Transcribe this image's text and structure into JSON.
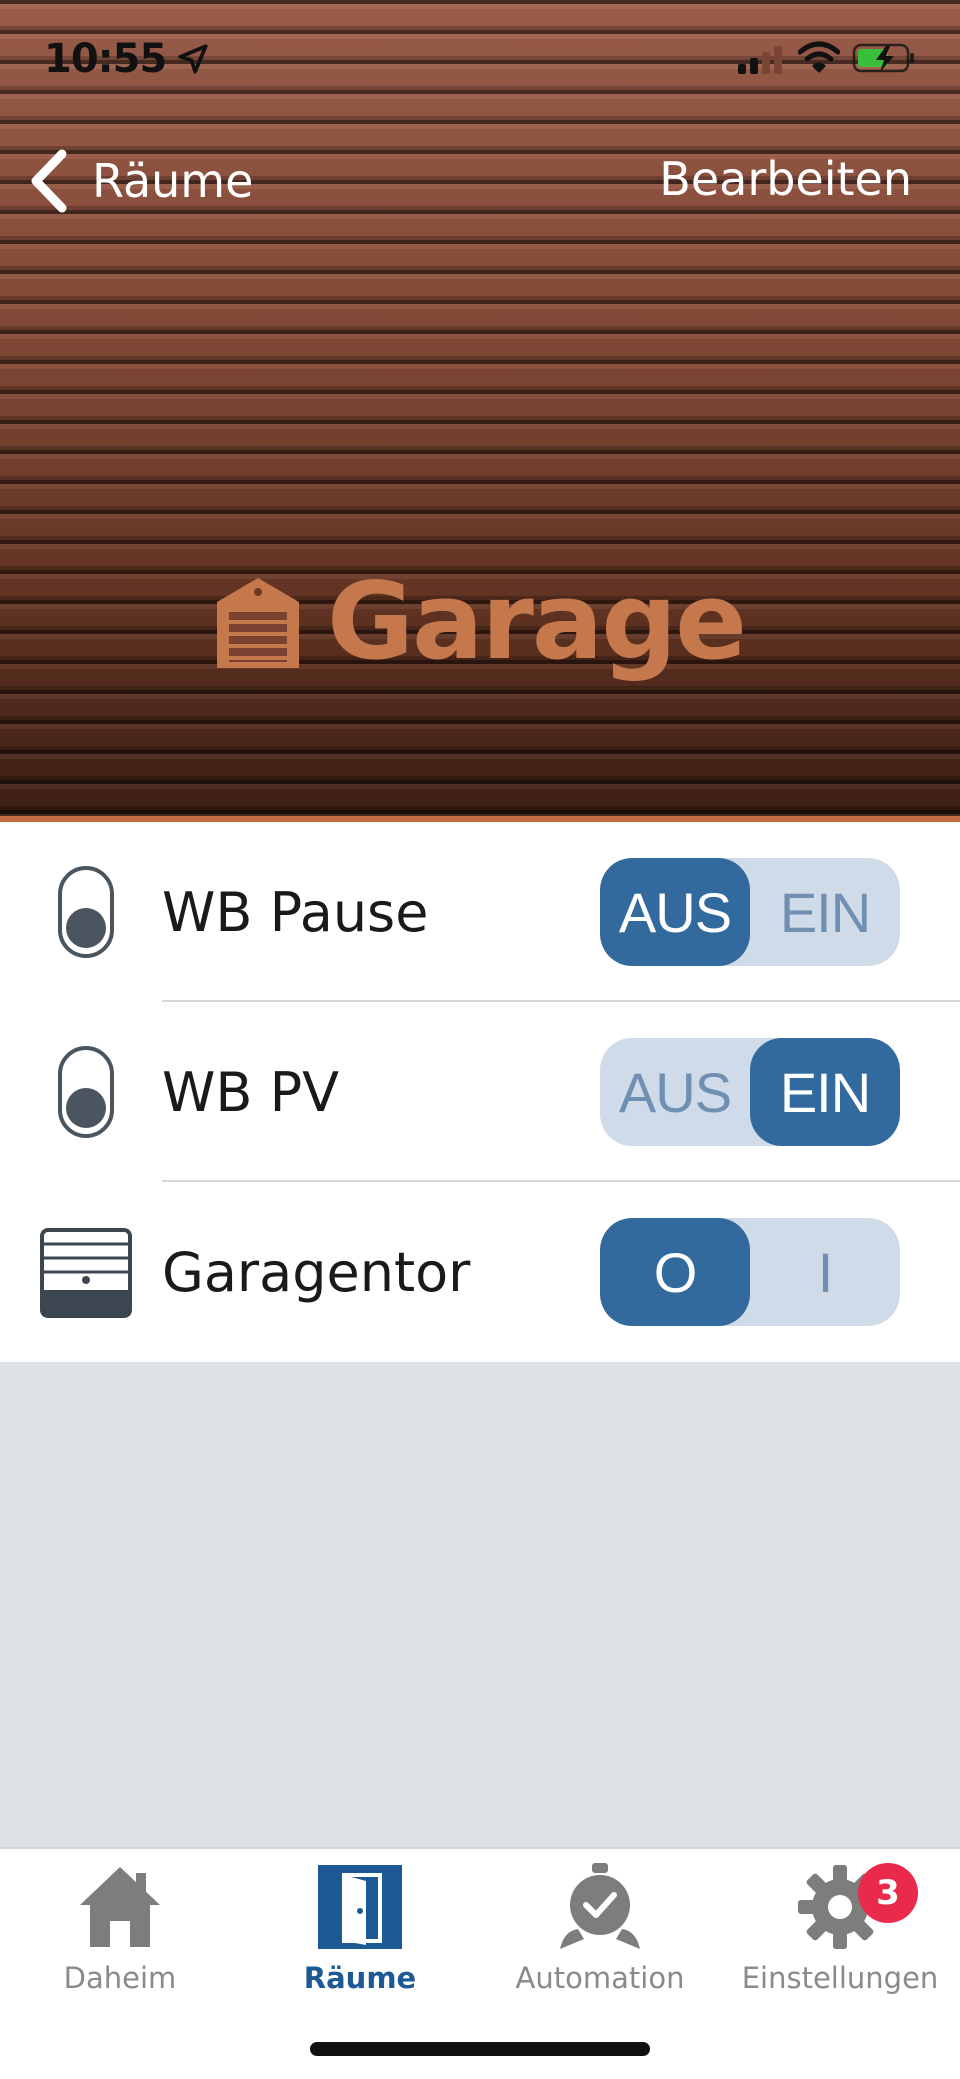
{
  "status_bar": {
    "time": "10:55"
  },
  "nav": {
    "back_label": "Räume",
    "edit_label": "Bearbeiten"
  },
  "room": {
    "title": "Garage",
    "accent_color": "#c6784d"
  },
  "rows": [
    {
      "label": "WB Pause",
      "icon": "switch-icon",
      "options": [
        "AUS",
        "EIN"
      ],
      "selected": "AUS"
    },
    {
      "label": "WB PV",
      "icon": "switch-icon",
      "options": [
        "AUS",
        "EIN"
      ],
      "selected": "EIN"
    },
    {
      "label": "Garagentor",
      "icon": "garage-door-icon",
      "options": [
        "O",
        "I"
      ],
      "selected": "O"
    }
  ],
  "tabs": [
    {
      "label": "Daheim",
      "icon": "home-icon",
      "active": false
    },
    {
      "label": "Räume",
      "icon": "door-icon",
      "active": true
    },
    {
      "label": "Automation",
      "icon": "timer-icon",
      "active": false
    },
    {
      "label": "Einstellungen",
      "icon": "gear-icon",
      "active": false,
      "badge": "3"
    }
  ],
  "colors": {
    "segment_active": "#336a9e",
    "segment_inactive": "#cfdbe8",
    "tab_active": "#1d5a94",
    "badge": "#ea2a4a"
  }
}
